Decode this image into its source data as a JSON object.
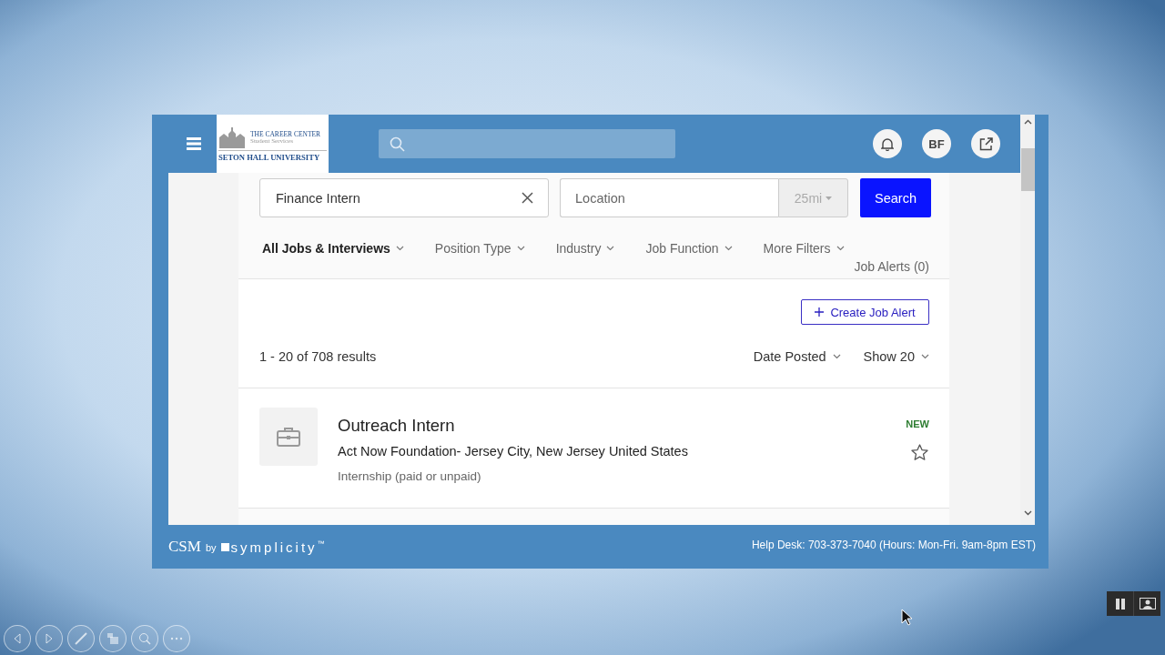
{
  "header": {
    "logo": {
      "title": "THE CAREER CENTER",
      "subtitle": "Student Services",
      "university": "SETON HALL UNIVERSITY"
    },
    "avatar": "BF"
  },
  "search": {
    "keyword": "Finance Intern",
    "location_placeholder": "Location",
    "radius": "25mi",
    "button": "Search"
  },
  "filters": [
    {
      "label": "All Jobs & Interviews",
      "selected": true
    },
    {
      "label": "Position Type",
      "selected": false
    },
    {
      "label": "Industry",
      "selected": false
    },
    {
      "label": "Job Function",
      "selected": false
    },
    {
      "label": "More Filters",
      "selected": false
    }
  ],
  "job_alerts": "Job Alerts (0)",
  "create_alert": "Create Job Alert",
  "results_count": "1 - 20 of 708 results",
  "sort": "Date Posted",
  "page_size": "Show 20",
  "jobs": [
    {
      "title": "Outreach Intern",
      "company": "Act Now Foundation- Jersey City, New Jersey United States",
      "type": "Internship (paid or unpaid)",
      "badge": "NEW",
      "starred": false
    }
  ],
  "footer": {
    "brand": "CSM",
    "by": "by",
    "vendor": "symplicity",
    "trademark": "™",
    "help": "Help Desk: 703-373-7040 (Hours: Mon-Fri. 9am-8pm EST)"
  }
}
